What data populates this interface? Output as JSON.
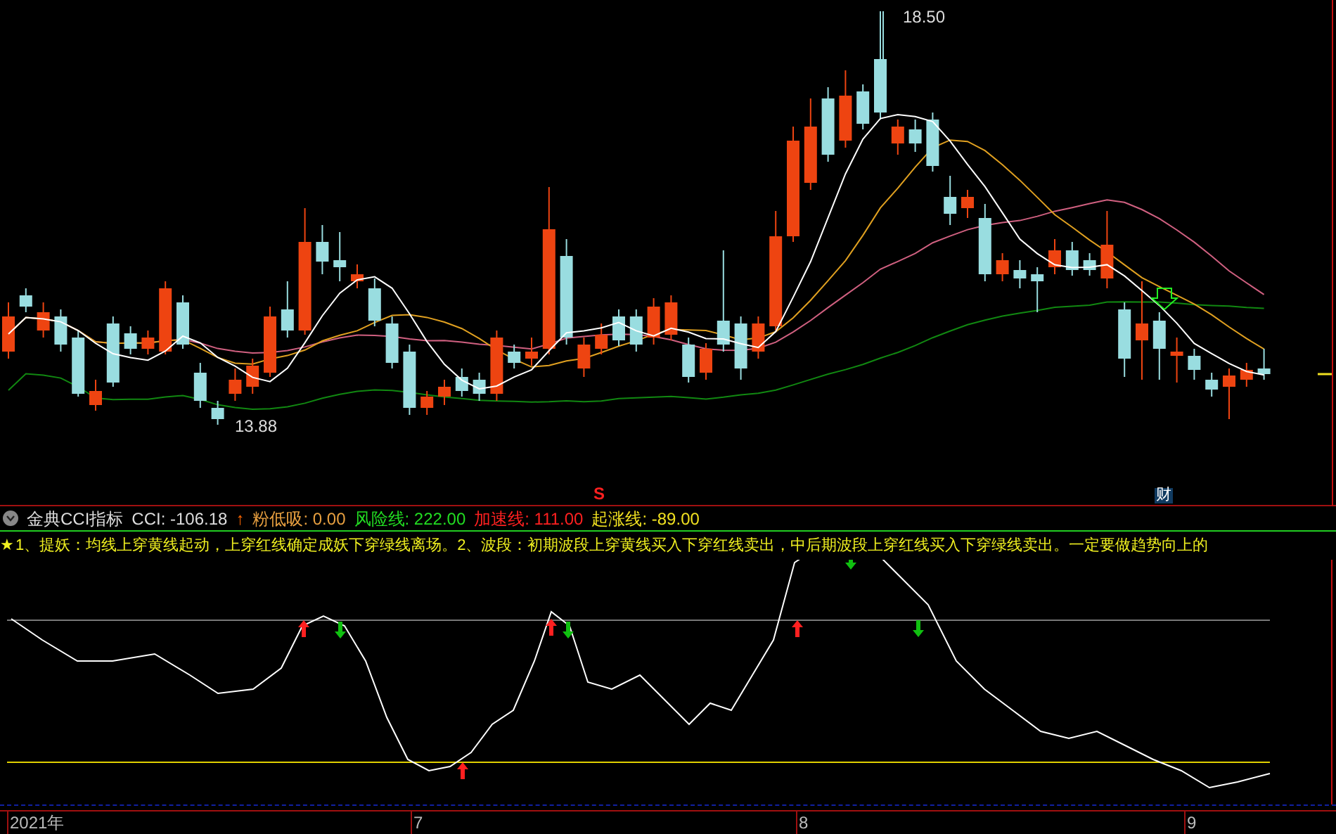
{
  "price_chart": {
    "high_label": "18.50",
    "low_label": "13.88",
    "signal_marker": "S",
    "finance_badge": "财"
  },
  "indicator_header": {
    "title": "金典CCI指标",
    "readouts": [
      {
        "text": "CCI: -106.18",
        "color": "#dddddd"
      },
      {
        "text": "↑",
        "color": "#ff6600"
      },
      {
        "text": "粉低吸: 0.00",
        "color": "#e8a040"
      },
      {
        "text": "风险线: 222.00",
        "color": "#22dd22"
      },
      {
        "text": "加速线: 111.00",
        "color": "#ff2020"
      },
      {
        "text": "起涨线: -89.00",
        "color": "#f0e020"
      }
    ]
  },
  "description": {
    "star": "★",
    "text": "1、提妖：均线上穿黄线起动，上穿红线确定成妖下穿绿线离场。2、波段：初期波段上穿黄线买入下穿红线卖出，中后期波段上穿红线买入下穿绿线卖出。一定要做趋势向上的"
  },
  "time_axis": [
    "2021年",
    "7",
    "8",
    "9"
  ]
}
